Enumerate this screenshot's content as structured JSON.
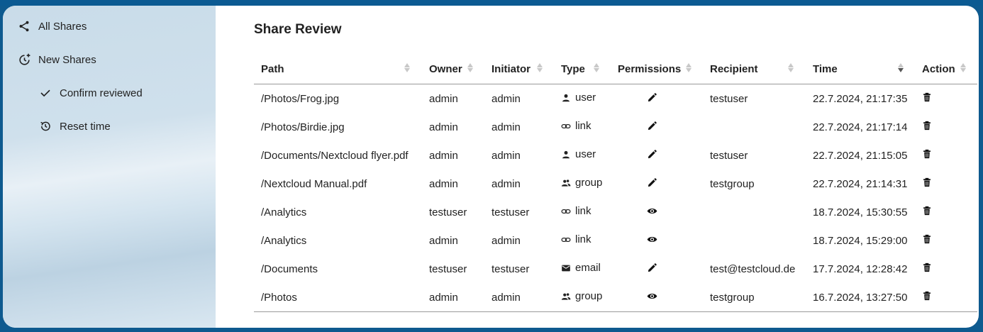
{
  "sidebar": {
    "items": [
      {
        "label": "All Shares",
        "icon": "share-icon"
      },
      {
        "label": "New Shares",
        "icon": "history-plus-icon"
      },
      {
        "label": "Confirm reviewed",
        "icon": "check-icon"
      },
      {
        "label": "Reset time",
        "icon": "history-icon"
      }
    ]
  },
  "main": {
    "title": "Share Review",
    "columns": [
      "Path",
      "Owner",
      "Initiator",
      "Type",
      "Permissions",
      "Recipient",
      "Time",
      "Action"
    ],
    "rows": [
      {
        "path": "/Photos/Frog.jpg",
        "owner": "admin",
        "initiator": "admin",
        "type": "user",
        "type_icon": "user-icon",
        "perm_icon": "pencil-icon",
        "recipient": "testuser",
        "time": "22.7.2024, 21:17:35"
      },
      {
        "path": "/Photos/Birdie.jpg",
        "owner": "admin",
        "initiator": "admin",
        "type": "link",
        "type_icon": "link-icon",
        "perm_icon": "pencil-icon",
        "recipient": "",
        "time": "22.7.2024, 21:17:14"
      },
      {
        "path": "/Documents/Nextcloud flyer.pdf",
        "owner": "admin",
        "initiator": "admin",
        "type": "user",
        "type_icon": "user-icon",
        "perm_icon": "pencil-icon",
        "recipient": "testuser",
        "time": "22.7.2024, 21:15:05"
      },
      {
        "path": "/Nextcloud Manual.pdf",
        "owner": "admin",
        "initiator": "admin",
        "type": "group",
        "type_icon": "group-icon",
        "perm_icon": "pencil-icon",
        "recipient": "testgroup",
        "time": "22.7.2024, 21:14:31"
      },
      {
        "path": "/Analytics",
        "owner": "testuser",
        "initiator": "testuser",
        "type": "link",
        "type_icon": "link-icon",
        "perm_icon": "eye-icon",
        "recipient": "",
        "time": "18.7.2024, 15:30:55"
      },
      {
        "path": "/Analytics",
        "owner": "admin",
        "initiator": "admin",
        "type": "link",
        "type_icon": "link-icon",
        "perm_icon": "eye-icon",
        "recipient": "",
        "time": "18.7.2024, 15:29:00"
      },
      {
        "path": "/Documents",
        "owner": "testuser",
        "initiator": "testuser",
        "type": "email",
        "type_icon": "email-icon",
        "perm_icon": "pencil-icon",
        "recipient": "test@testcloud.de",
        "time": "17.7.2024, 12:28:42"
      },
      {
        "path": "/Photos",
        "owner": "admin",
        "initiator": "admin",
        "type": "group",
        "type_icon": "group-icon",
        "perm_icon": "eye-icon",
        "recipient": "testgroup",
        "time": "16.7.2024, 13:27:50"
      }
    ]
  }
}
